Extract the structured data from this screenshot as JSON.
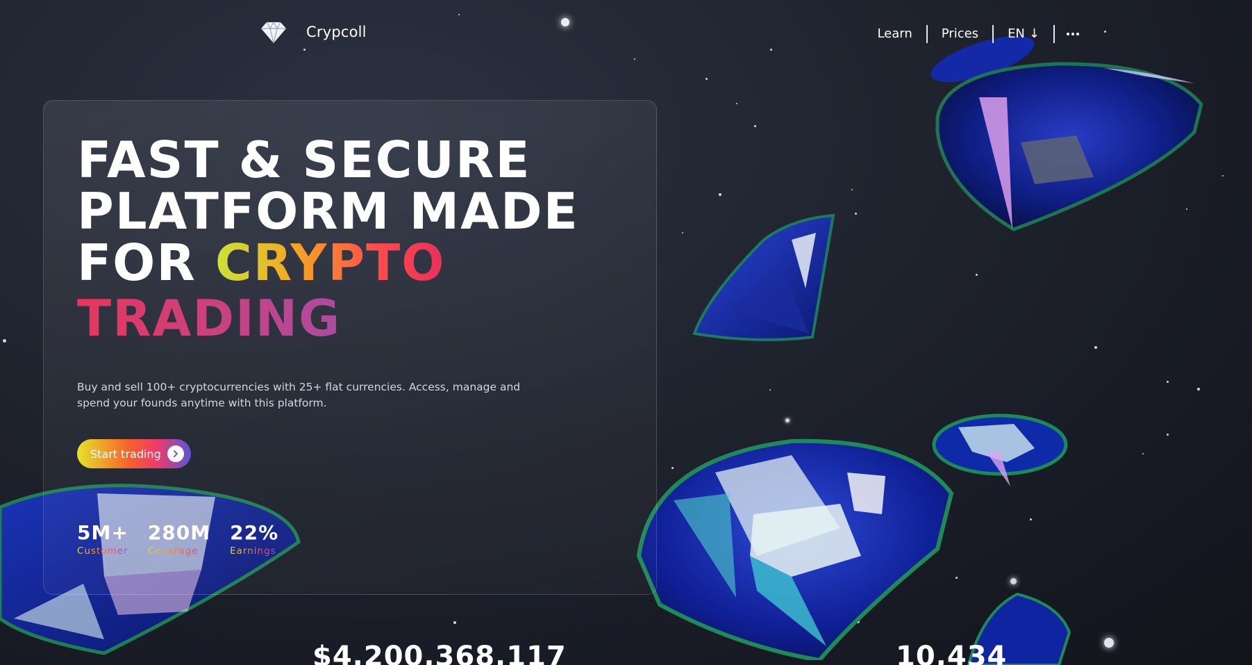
{
  "brand": {
    "name": "Crypcoll",
    "logo_icon": "diamond-logo-icon"
  },
  "nav": {
    "items": [
      {
        "label": "Learn"
      },
      {
        "label": "Prices"
      },
      {
        "label": "EN",
        "arrow": "↓"
      }
    ],
    "more_icon": "more-dots-icon"
  },
  "hero": {
    "line1": "FAST & SECURE",
    "line2": "PLATFORM MADE",
    "line3_plain": "FOR ",
    "line3_gradient": "CRYPTO",
    "line4_gradient": "TRADING",
    "description": "Buy and sell 100+ cryptocurrencies with 25+ flat currencies. Access, manage and spend your founds anytime with this platform.",
    "cta_label": "Start trading",
    "cta_icon": "chevron-right-circle-icon",
    "gradient_colors": [
      "#c9e438",
      "#f5a524",
      "#ff4c4c",
      "#e8305c",
      "#5a63d6"
    ]
  },
  "stats": [
    {
      "value": "5M+",
      "label": "Customer"
    },
    {
      "value": "280M",
      "label": "Coverage"
    },
    {
      "value": "22%",
      "label": "Earnings"
    }
  ],
  "bottom_stats": {
    "left_value": "$4,200,368,117",
    "right_value": "10,434"
  },
  "colors": {
    "background": "#1f232e",
    "gem_blue": "#1b2fb8",
    "gem_green": "#1f8a5a",
    "gem_teal": "#40d6d0"
  }
}
